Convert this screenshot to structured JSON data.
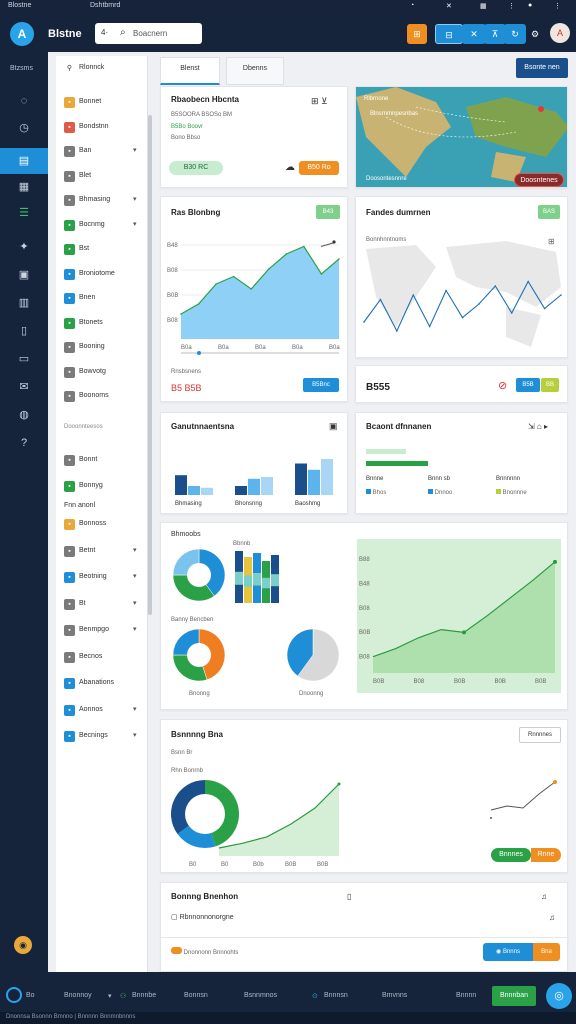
{
  "topstrip": {
    "left": "Blostne",
    "tab": "Dshtbmrd"
  },
  "header": {
    "brand": "Blstne",
    "search_prefix": "4·",
    "search_placeholder": "Boacnern",
    "search_icon": "search-icon",
    "icons": [
      "notification-icon",
      "grid-icon",
      "close-icon",
      "pin-icon",
      "refresh-icon",
      "settings-icon"
    ],
    "avatar_initial": "A"
  },
  "rail": {
    "label": "Btzsms",
    "items": [
      "chat-icon",
      "clock-icon",
      "table-icon",
      "grid-icon",
      "list-icon",
      "tools-icon",
      "calendar-icon",
      "report-icon",
      "book-icon",
      "doc-icon",
      "mail-icon",
      "globe-icon",
      "help-icon"
    ],
    "active_index": 3
  },
  "sidebar": {
    "header": "Rlonnck",
    "items": [
      {
        "label": "Bonnet",
        "color": "#e8a93a",
        "chevron": false
      },
      {
        "label": "Bondstnn",
        "color": "#e05a4a",
        "chevron": false
      },
      {
        "label": "Ban",
        "color": "#7a7a7a",
        "chevron": true
      },
      {
        "label": "Blet",
        "color": "#7a7a7a",
        "chevron": false
      },
      {
        "label": "Bhmasing",
        "color": "#7a7a7a",
        "chevron": true
      },
      {
        "label": "Bocnmg",
        "color": "#2aa147",
        "chevron": true
      },
      {
        "label": "Bst",
        "color": "#2aa147",
        "chevron": false
      },
      {
        "label": "Broniotome",
        "color": "#1e8fd6",
        "chevron": false
      },
      {
        "label": "Bnen",
        "color": "#1e8fd6",
        "chevron": false
      },
      {
        "label": "Btonets",
        "color": "#2aa147",
        "chevron": false
      },
      {
        "label": "Booning",
        "color": "#7a7a7a",
        "chevron": false
      },
      {
        "label": "Bowvotg",
        "color": "#7a7a7a",
        "chevron": false
      },
      {
        "label": "Boonoms",
        "color": "#7a7a7a",
        "chevron": false
      }
    ],
    "section": "Dooonnteesos",
    "items2": [
      {
        "label": "Bonnt",
        "color": "#7a7a7a",
        "chevron": false
      },
      {
        "label": "Bonnyg",
        "color": "#2aa147",
        "chevron": false
      }
    ],
    "subhead": "Fnn anonl",
    "items3": [
      {
        "label": "Bonnoss",
        "color": "#e8a93a",
        "chevron": false
      },
      {
        "label": "Betnt",
        "color": "#7a7a7a",
        "chevron": true
      },
      {
        "label": "Beotning",
        "color": "#1e8fd6",
        "chevron": true
      },
      {
        "label": "Bt",
        "color": "#7a7a7a",
        "chevron": true
      },
      {
        "label": "Benmpgo",
        "color": "#7a7a7a",
        "chevron": true
      },
      {
        "label": "Becnos",
        "color": "#7a7a7a",
        "chevron": false
      },
      {
        "label": "Abanations",
        "color": "#1e8fd6",
        "chevron": false
      },
      {
        "label": "Aonnos",
        "color": "#1e8fd6",
        "chevron": true
      },
      {
        "label": "Becnings",
        "color": "#1e8fd6",
        "chevron": true
      }
    ]
  },
  "tabs": [
    "Blenst",
    "Dbenns"
  ],
  "export_button": "Bsonte nen",
  "card1": {
    "title": "Rbaobecn Hbcnta",
    "sub1": "B5SOORA BSOSo BM",
    "sub2": "B5Bo Boovr",
    "sub3": "Bono Bbso",
    "pill": "B30 RC",
    "btn": "B50 Ro"
  },
  "map_card": {
    "label1": "Rlbrnone",
    "label2": "Blnsrnmnpesnbas",
    "foot": "Doosontesnnre",
    "btn": "Doosntenes"
  },
  "chart1": {
    "title": "Ras Blonbng",
    "badge": "B43",
    "chart_data": {
      "type": "area",
      "x": [
        "B0a",
        "B0a",
        "B0a",
        "B0a",
        "B0a"
      ],
      "y_ticks": [
        "B48",
        "B08",
        "B0B",
        "B08"
      ],
      "values": [
        20,
        28,
        44,
        50,
        40,
        56,
        68,
        74,
        52,
        64
      ]
    },
    "footer_label": "Rnsbsnens",
    "footer_value": "B5 B5B",
    "footer_btn": "B5Bnc"
  },
  "chart2": {
    "title": "Fandes dumrnen",
    "badge": "BAS",
    "legend": "Bonnhnntnoms",
    "chart_data": {
      "type": "line",
      "values": [
        30,
        55,
        20,
        60,
        25,
        65,
        35,
        50,
        70,
        40,
        75,
        45,
        60
      ]
    },
    "stat": "B555",
    "btn1": "B5B",
    "btn2": "BB"
  },
  "bars_card": {
    "title": "Ganutnnaentsna",
    "chart_data": {
      "type": "bar",
      "categories": [
        "Bhmasing",
        "Bhonsnng",
        "Baoshmg"
      ],
      "series": [
        {
          "values": [
            22,
            10,
            35
          ]
        },
        {
          "values": [
            10,
            18,
            28
          ]
        },
        {
          "values": [
            8,
            20,
            40
          ]
        }
      ]
    }
  },
  "recent_card": {
    "title": "Bcaont dfnnanen",
    "items": [
      "Bnnne",
      "Bnnn sb",
      "Bnnnnnn"
    ],
    "subs": [
      "Bhos",
      "Dnnoo",
      "Bnonnne"
    ]
  },
  "big_card": {
    "title": "Bhmoobs",
    "sub": "Bbnnb",
    "donut1": {
      "chart_data": {
        "type": "pie",
        "values": [
          40,
          35,
          25
        ]
      }
    },
    "col_bars": {
      "chart_data": {
        "type": "bar",
        "values": [
          52,
          46,
          50,
          42,
          48
        ]
      }
    },
    "section": "Banny Bencben",
    "donut2": {
      "label": "Bnonng",
      "chart_data": {
        "type": "pie",
        "values": [
          45,
          30,
          25
        ]
      }
    },
    "pie3": {
      "label": "Dnoonng",
      "chart_data": {
        "type": "pie",
        "values": [
          60,
          40
        ]
      }
    },
    "area": {
      "chart_data": {
        "type": "area",
        "x": [
          "B0B",
          "B08",
          "B0B",
          "B0B",
          "B0B"
        ],
        "y_ticks": [
          "B88",
          "B48",
          "B08",
          "B0B",
          "B08"
        ],
        "values": [
          12,
          18,
          26,
          32,
          30,
          42,
          55,
          68,
          82
        ]
      }
    }
  },
  "growth_card": {
    "title": "Bsnnnng Bna",
    "sub": "Bsnn Br",
    "sub2": "Rhn Bonrnb",
    "btn": "Rnnnnes",
    "chart_data": {
      "type": "area",
      "x": [
        "B0",
        "B0",
        "B0b",
        "B0B",
        "B0B"
      ],
      "values": [
        5,
        8,
        12,
        20,
        30,
        45
      ]
    },
    "mini_line": {
      "chart_data": {
        "type": "line",
        "values": [
          4,
          6,
          5,
          12,
          18
        ]
      }
    },
    "tag1": "Bnnnes",
    "tag2": "Rnne"
  },
  "bottom_card": {
    "title": "Bonnng Bnenhon",
    "item": "Rbnnonnonorgne",
    "row2": "Dnonnonn Bnnnohts",
    "btn1": "Bnnns",
    "btn2": "Bna"
  },
  "bottombar": {
    "items": [
      "Bo",
      "Bnonnoy",
      "Bnnnbe",
      "Bonnsn",
      "Bsnnmnos",
      "Bnnnsn",
      "Bmvnns",
      "Bnnnn"
    ],
    "cta": "Bnnnban"
  },
  "footer": "Dnonnsa Bsonnn Bmnno | Bnnnnn Bnnmnbnnns"
}
